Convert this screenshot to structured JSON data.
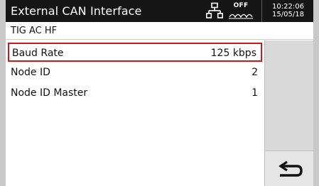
{
  "header": {
    "title": "External CAN Interface",
    "status_label": "OFF",
    "time": "10:22:06",
    "date": "15/05/18",
    "network_icon": "network-icon",
    "wave_icon": "wave-icon"
  },
  "subheader": {
    "mode": "TIG AC HF"
  },
  "list": {
    "items": [
      {
        "label": "Baud Rate",
        "value": "125 kbps",
        "selected": true
      },
      {
        "label": "Node ID",
        "value": "2",
        "selected": false
      },
      {
        "label": "Node ID Master",
        "value": "1",
        "selected": false
      }
    ]
  },
  "controls": {
    "back_icon": "back-arrow-icon"
  },
  "colors": {
    "header_bg": "#151515",
    "selection_border": "#d01818",
    "panel_bg": "#d9d9d9"
  }
}
